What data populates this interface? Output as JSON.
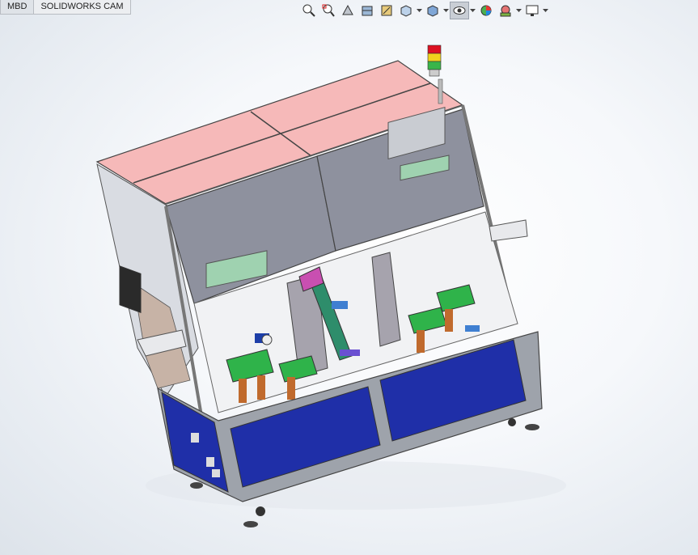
{
  "tabs": [
    {
      "label": "MBD",
      "active": true
    },
    {
      "label": "SOLIDWORKS CAM",
      "active": false
    }
  ],
  "toolbar": {
    "icons": [
      "zoom-to-fit-icon",
      "zoom-to-area-icon",
      "previous-view-icon",
      "section-view-icon",
      "dynamic-annotation-icon",
      "view-orientation-icon",
      "display-style-icon",
      "hide-show-items-icon",
      "edit-appearance-icon",
      "apply-scene-icon",
      "view-settings-icon"
    ]
  },
  "colors": {
    "top_panel": "#f6b9b9",
    "front_glass": "#8e919e",
    "frame": "#a8adb5",
    "base_panel": "#1f2fa8",
    "green_parts": "#2fb34a"
  }
}
